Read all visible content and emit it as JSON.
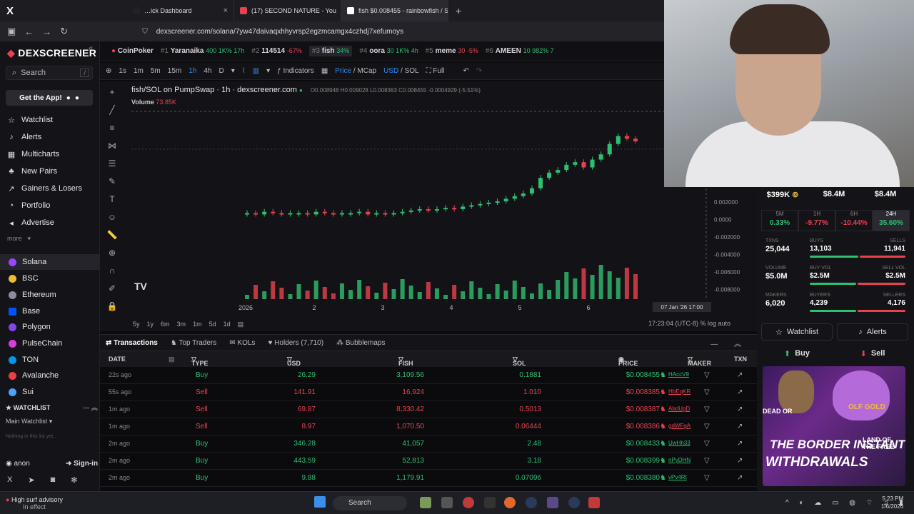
{
  "browser": {
    "tabs": [
      {
        "label": "…ick Dashboard",
        "color": "#e9424f"
      },
      {
        "label": "(17) SECOND NATURE - You",
        "color": "#e9424f"
      },
      {
        "label": "fish $0.008455 - rainbowfish / S",
        "color": "#ffffff"
      }
    ],
    "url": "dexscreener.com/solana/7yw47daivaqxhhyvrsp2egzmcamgx4czhdj7xefumoys"
  },
  "trending": [
    {
      "rank": "",
      "name": "CoinPoker",
      "pct": "",
      "cls": ""
    },
    {
      "rank": "#1",
      "name": "Yaranaika",
      "pct": "400 1K% 17h",
      "cls": "green"
    },
    {
      "rank": "#2",
      "name": "114514",
      "pct": "-67%",
      "cls": "red"
    },
    {
      "rank": "#3",
      "name": "fish",
      "pct": "34%",
      "cls": "green"
    },
    {
      "rank": "#4",
      "name": "oora",
      "pct": "30 1K% 4h",
      "cls": "green"
    },
    {
      "rank": "#5",
      "name": "meme",
      "pct": "30 -5%",
      "cls": "red"
    },
    {
      "rank": "#6",
      "name": "AMEEN",
      "pct": "10 982% 7",
      "cls": "green"
    }
  ],
  "sidebar": {
    "logo": "DEXSCREENER",
    "search": "Search",
    "search_kbd": "/",
    "get_app": "Get the App!",
    "items": [
      {
        "label": "Watchlist",
        "icon": "star-icon"
      },
      {
        "label": "Alerts",
        "icon": "bell-icon"
      },
      {
        "label": "Multicharts",
        "icon": "grid-icon"
      },
      {
        "label": "New Pairs",
        "icon": "sprout-icon"
      },
      {
        "label": "Gainers & Losers",
        "icon": "trend-icon"
      },
      {
        "label": "Portfolio",
        "icon": "pie-icon"
      },
      {
        "label": "Advertise",
        "icon": "megaphone-icon"
      }
    ],
    "more": "more",
    "chains": [
      {
        "label": "Solana",
        "color": "#9945ff"
      },
      {
        "label": "BSC",
        "color": "#f3ba2f"
      },
      {
        "label": "Ethereum",
        "color": "#8c8c9c"
      },
      {
        "label": "Base",
        "color": "#0052ff"
      },
      {
        "label": "Polygon",
        "color": "#8247e5"
      },
      {
        "label": "PulseChain",
        "color": "#d63fd6"
      },
      {
        "label": "TON",
        "color": "#0098ea"
      },
      {
        "label": "Avalanche",
        "color": "#e84142"
      },
      {
        "label": "Sui",
        "color": "#4da2ff"
      }
    ],
    "watchlist_head": "WATCHLIST",
    "watchlist_main": "Main Watchlist",
    "watchlist_empty": "Nothing in this list yet...",
    "user": "anon",
    "signin": "Sign-in"
  },
  "toolbar": {
    "intervals": [
      "1s",
      "1m",
      "5m",
      "15m",
      "1h",
      "4h",
      "D"
    ],
    "selected": "1h",
    "indicators": "Indicators",
    "price": "Price",
    "mcap": "MCap",
    "usd": "USD",
    "sol": "SOL",
    "full": "Full"
  },
  "chart_header": {
    "title": "fish/SOL on PumpSwap · 1h · dexscreener.com",
    "ohlc": "O0.008948 H0.009028 L0.008363 C0.008455 -0.0004929 (-5.51%)",
    "volume_label": "Volume",
    "volume_value": "73.85K"
  },
  "chart_data": {
    "type": "candlestick",
    "x_ticks": [
      "2026",
      "2",
      "3",
      "4",
      "5",
      "6"
    ],
    "y_ticks": [
      "0.002000",
      "0.0000",
      "-0.002000",
      "-0.004000",
      "-0.006000",
      "-0.008000"
    ],
    "crosshair_label": "07 Jan '26   17:00",
    "price_axis_top": [
      "$399K",
      "$8.4M",
      "$8.4M"
    ],
    "series": [
      {
        "name": "price",
        "values": [
          0.0003,
          0.0002,
          0.0004,
          0.0003,
          0.0002,
          0.0003,
          0.0003,
          0.0002,
          0.0004,
          0.0003,
          0.0002,
          0.0003,
          0.0003,
          0.0004,
          0.0002,
          0.0003,
          0.0002,
          0.0003,
          0.0004,
          0.0005,
          0.0006,
          0.0005,
          0.0006,
          0.0007,
          0.0006,
          0.0008,
          0.0009,
          0.001,
          0.0011,
          0.0012,
          0.0014,
          0.0016,
          0.0018,
          0.0022,
          0.003,
          0.0034,
          0.0036,
          0.004,
          0.0042,
          0.0038,
          0.0044,
          0.0048,
          0.0056,
          0.0062,
          0.006,
          0.0058
        ]
      }
    ]
  },
  "ranges": [
    "5y",
    "1y",
    "6m",
    "3m",
    "1m",
    "5d",
    "1d"
  ],
  "range_right": "17:23:04 (UTC-8)   %   log   auto",
  "stats": {
    "top": [
      "$399K",
      "$8.4M",
      "$8.4M"
    ],
    "timeframes": [
      {
        "label": "5M",
        "value": "0.33%",
        "cls": "green"
      },
      {
        "label": "1H",
        "value": "-9.77%",
        "cls": "red"
      },
      {
        "label": "6H",
        "value": "-10.44%",
        "cls": "red"
      },
      {
        "label": "24H",
        "value": "35.60%",
        "cls": "green"
      }
    ],
    "txns": {
      "label": "TXNS",
      "value": "25,044",
      "buys_label": "BUYS",
      "buys": "13,103",
      "sells_label": "SELLS",
      "sells": "11,941",
      "buy_ratio": 0.52
    },
    "volume": {
      "label": "VOLUME",
      "value": "$5.0M",
      "buys_label": "BUY VOL",
      "buys": "$2.5M",
      "sells_label": "SELL VOL",
      "sells": "$2.5M",
      "buy_ratio": 0.5
    },
    "makers": {
      "label": "MAKERS",
      "value": "6,020",
      "buys_label": "BUYERS",
      "buys": "4,239",
      "sells_label": "SELLERS",
      "sells": "4,176",
      "buy_ratio": 0.5
    },
    "watchlist": "Watchlist",
    "alerts": "Alerts",
    "buy": "Buy",
    "sell": "Sell"
  },
  "ad": {
    "line1": "THE BORDER INSTANT",
    "line2": "WITHDRAWALS",
    "tag1": "DEAD OR",
    "tag2": "OLF GOLD",
    "tag3": "LAND OF THE FREE"
  },
  "txn_tabs": [
    "Transactions",
    "Top Traders",
    "KOLs",
    "Holders (7,710)",
    "Bubblemaps"
  ],
  "table": {
    "headers": [
      "DATE",
      "TYPE",
      "USD",
      "FISH",
      "SOL",
      "PRICE",
      "MAKER",
      "TXN"
    ],
    "rows": [
      {
        "date": "22s ago",
        "type": "Buy",
        "usd": "26.29",
        "fish": "3,109.56",
        "sol": "0.1881",
        "price": "$0.008455",
        "maker": "HAccV9"
      },
      {
        "date": "55s ago",
        "type": "Sell",
        "usd": "141.91",
        "fish": "16,924",
        "sol": "1.010",
        "price": "$0.008385",
        "maker": "HbEqKR"
      },
      {
        "date": "1m ago",
        "type": "Sell",
        "usd": "69.87",
        "fish": "8,330.42",
        "sol": "0.5013",
        "price": "$0.008387",
        "maker": "AbdUgD"
      },
      {
        "date": "1m ago",
        "type": "Sell",
        "usd": "8.97",
        "fish": "1,070.50",
        "sol": "0.06444",
        "price": "$0.008386",
        "maker": "gdWFgA"
      },
      {
        "date": "2m ago",
        "type": "Buy",
        "usd": "346.28",
        "fish": "41,057",
        "sol": "2.48",
        "price": "$0.008433",
        "maker": "UwHh33"
      },
      {
        "date": "2m ago",
        "type": "Buy",
        "usd": "443.59",
        "fish": "52,813",
        "sol": "3.18",
        "price": "$0.008399",
        "maker": "nPyDHN"
      },
      {
        "date": "2m ago",
        "type": "Buy",
        "usd": "9.88",
        "fish": "1,179.91",
        "sol": "0.07096",
        "price": "$0.008380",
        "maker": "vPv4Rt"
      }
    ]
  },
  "taskbar": {
    "weather": "High surf advisory",
    "weather_sub": "In effect",
    "search": "Search",
    "time": "5:23 PM",
    "date": "1/6/2026"
  }
}
